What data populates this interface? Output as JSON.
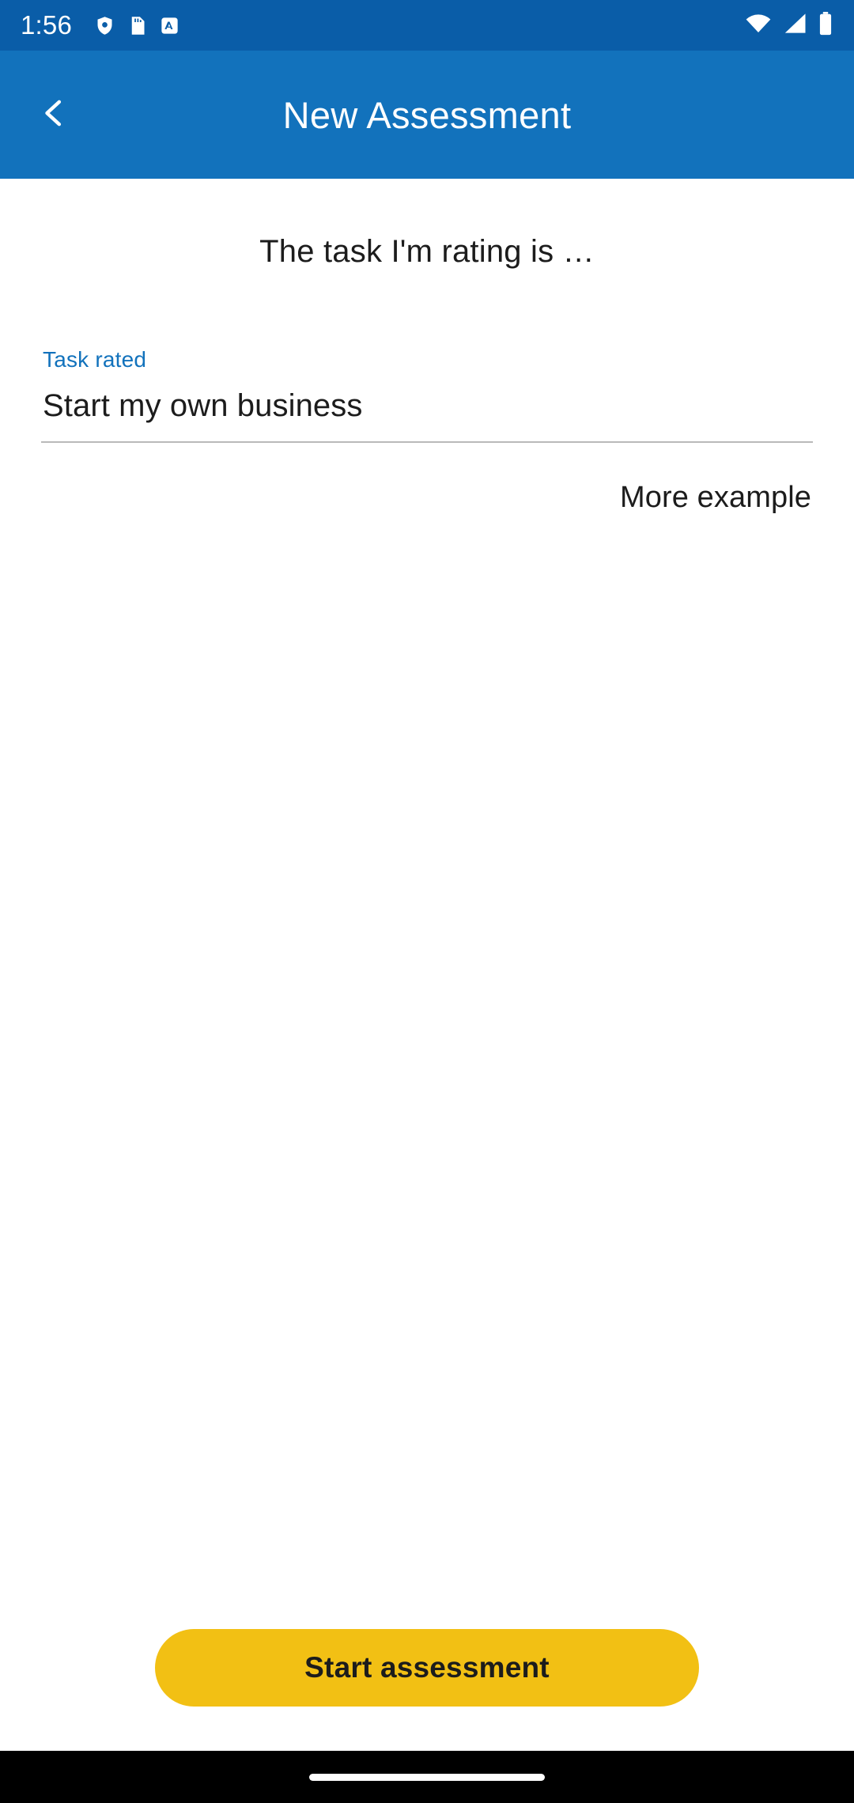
{
  "status_bar": {
    "time": "1:56",
    "left_icons": [
      "shield-icon",
      "sd-card-icon",
      "app-badge-icon"
    ],
    "right_icons": [
      "wifi-icon",
      "cellular-signal-icon",
      "battery-icon"
    ],
    "background_color": "#0a5da8"
  },
  "app_bar": {
    "title": "New Assessment",
    "back_icon": "back-chevron-icon",
    "background_color": "#1272bc",
    "title_color": "#ffffff"
  },
  "main": {
    "prompt": "The task I'm rating is …",
    "task_field": {
      "label": "Task rated",
      "value": "Start my own business",
      "placeholder": "Task rated",
      "label_color": "#1272bc"
    },
    "more_example_link": "More example"
  },
  "footer": {
    "primary_button": "Start assessment",
    "primary_button_color": "#f2c014",
    "primary_button_text_color": "#1c1c1c"
  },
  "navigation_bar": {
    "gesture_pill": "home-gesture-pill"
  }
}
